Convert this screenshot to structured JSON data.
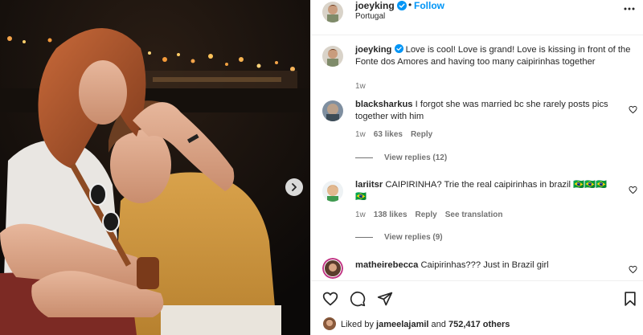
{
  "photo": {
    "alt_next": "Next"
  },
  "header": {
    "username": "joeyking",
    "separator": "•",
    "follow_label": "Follow",
    "location": "Portugal"
  },
  "caption": {
    "username": "joeyking",
    "text": "Love is cool! Love is grand! Love is kissing in front of the Fonte dos Amores and having too many caipirinhas together",
    "time": "1w"
  },
  "comments": [
    {
      "username": "blacksharkus",
      "text": "I forgot she was married bc she rarely posts pics together with him",
      "time": "1w",
      "likes": "63 likes",
      "reply": "Reply",
      "view_replies": "View replies (12)"
    },
    {
      "username": "lariitsr",
      "text": "CAIPIRINHA? Trie the real caipirinhas in brazil 🇧🇷🇧🇷🇧🇷🇧🇷",
      "time": "1w",
      "likes": "138 likes",
      "reply": "Reply",
      "translate": "See translation",
      "view_replies": "View replies (9)"
    },
    {
      "username": "matheirebecca",
      "text": "Caipirinhas??? Just in Brazil girl"
    }
  ],
  "liked_by": {
    "prefix": "Liked by",
    "user": "jameelajamil",
    "and": "and",
    "others": "752,417 others"
  },
  "colors": {
    "accent": "#0095f6",
    "verified": "#0095f6",
    "text": "#262626",
    "secondary": "#737373"
  },
  "icons": [
    "verified-icon",
    "more-icon",
    "heart-icon",
    "comment-icon",
    "share-icon",
    "save-icon",
    "chevron-right-icon"
  ]
}
